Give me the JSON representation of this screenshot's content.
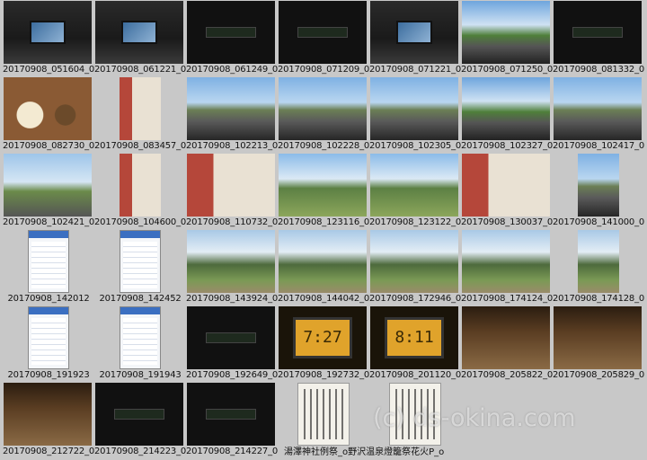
{
  "thumbnails": [
    {
      "caption": "20170908_051604_0",
      "style": "dash"
    },
    {
      "caption": "20170908_061221_0",
      "style": "dash"
    },
    {
      "caption": "20170908_061249_0",
      "style": "night"
    },
    {
      "caption": "20170908_071209_0",
      "style": "night"
    },
    {
      "caption": "20170908_071221_0",
      "style": "dash"
    },
    {
      "caption": "20170908_071250_0",
      "style": "road green"
    },
    {
      "caption": "20170908_081332_0",
      "style": "night"
    },
    {
      "caption": "20170908_082730_0",
      "style": "food"
    },
    {
      "caption": "20170908_083457_0",
      "style": "shop",
      "shape": "portrait"
    },
    {
      "caption": "20170908_102213_0",
      "style": "road"
    },
    {
      "caption": "20170908_102228_0",
      "style": "road"
    },
    {
      "caption": "20170908_102305_0",
      "style": "road"
    },
    {
      "caption": "20170908_102327_0",
      "style": "road green"
    },
    {
      "caption": "20170908_102417_0",
      "style": "road"
    },
    {
      "caption": "20170908_102421_0",
      "style": "sign"
    },
    {
      "caption": "20170908_104600_0",
      "style": "shop",
      "shape": "portrait"
    },
    {
      "caption": "20170908_110732_0",
      "style": "shop"
    },
    {
      "caption": "20170908_123116_0",
      "style": "field"
    },
    {
      "caption": "20170908_123122_0",
      "style": "field"
    },
    {
      "caption": "20170908_130037_0",
      "style": "shop"
    },
    {
      "caption": "20170908_141000_0",
      "style": "road",
      "shape": "portrait"
    },
    {
      "caption": "20170908_142012",
      "style": "phone",
      "shape": "portrait"
    },
    {
      "caption": "20170908_142452",
      "style": "phone",
      "shape": "portrait"
    },
    {
      "caption": "20170908_143924_0",
      "style": "mtn"
    },
    {
      "caption": "20170908_144042_0",
      "style": "mtn"
    },
    {
      "caption": "20170908_172946_0",
      "style": "mtn"
    },
    {
      "caption": "20170908_174124_0",
      "style": "mtn"
    },
    {
      "caption": "20170908_174128_0",
      "style": "mtn",
      "shape": "portrait"
    },
    {
      "caption": "20170908_191923",
      "style": "phone",
      "shape": "portrait"
    },
    {
      "caption": "20170908_191943",
      "style": "phone",
      "shape": "portrait"
    },
    {
      "caption": "20170908_192649_0",
      "style": "night"
    },
    {
      "caption": "20170908_192732_0",
      "style": "clock",
      "display": "7:27"
    },
    {
      "caption": "20170908_201120_0",
      "style": "clock",
      "display": "8:11"
    },
    {
      "caption": "20170908_205822_0",
      "style": "temple"
    },
    {
      "caption": "20170908_205829_0",
      "style": "temple"
    },
    {
      "caption": "20170908_212722_0",
      "style": "temple"
    },
    {
      "caption": "20170908_214223_0",
      "style": "night"
    },
    {
      "caption": "20170908_214227_0",
      "style": "night"
    },
    {
      "caption": "",
      "style": "paper",
      "shape": "doc"
    },
    {
      "caption": "",
      "style": "paper",
      "shape": "doc"
    }
  ],
  "footer_caption": "湯澤神社例祭_o野沢温泉燈籠祭花火P_o",
  "watermark": "(c) ds-okina.com"
}
